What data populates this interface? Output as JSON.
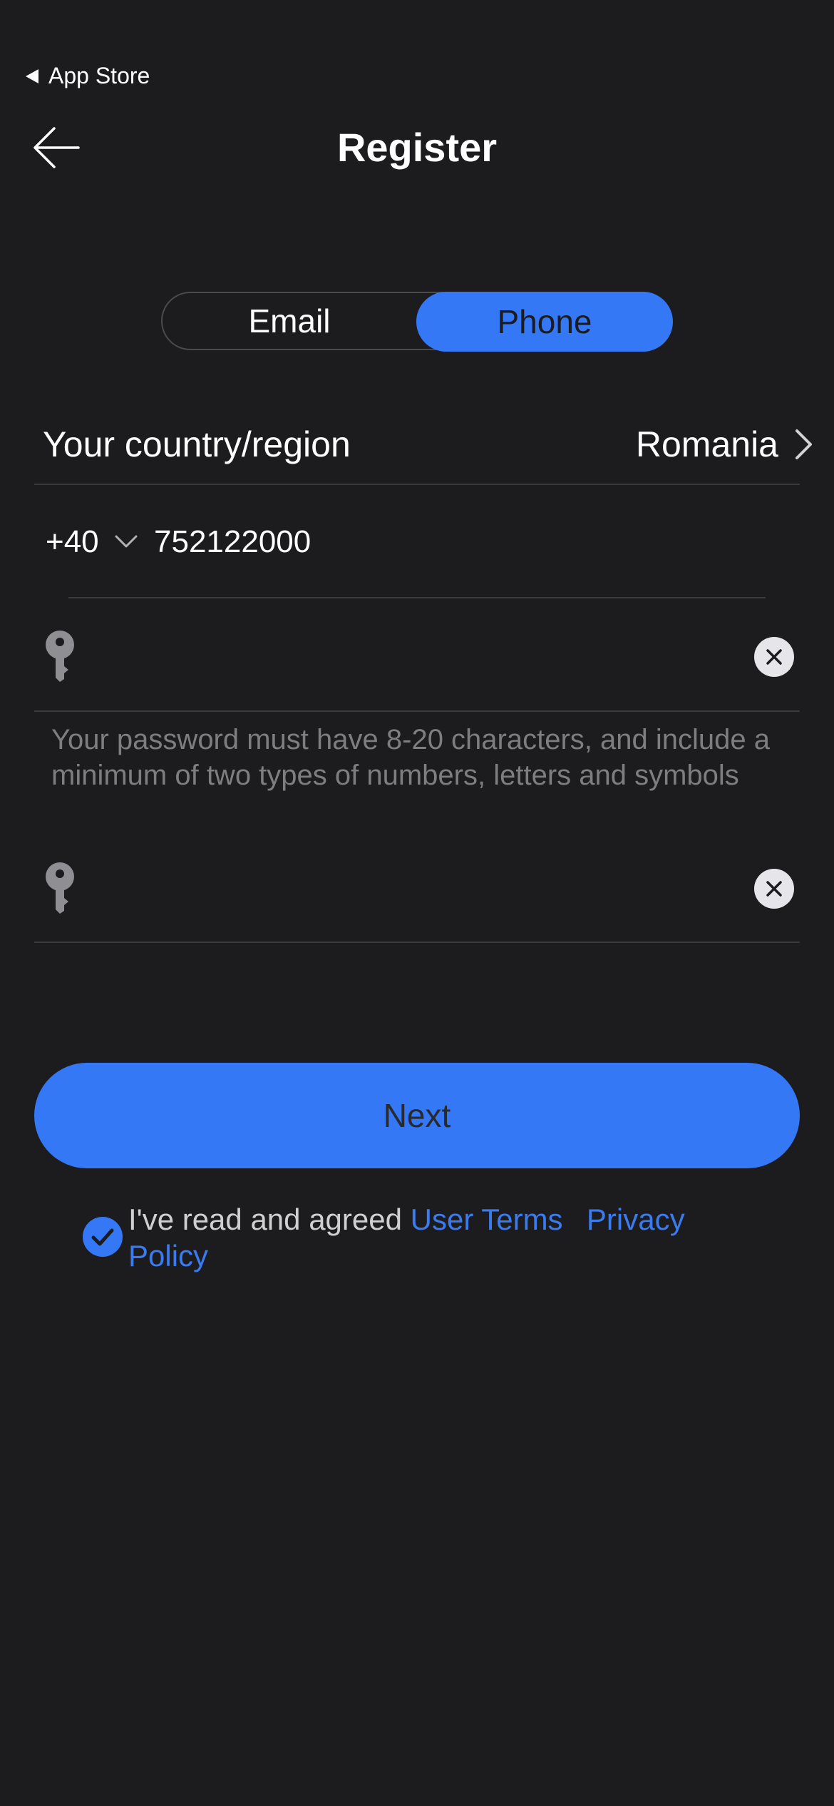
{
  "status_bar": {
    "back_to_app_label": "App Store"
  },
  "header": {
    "title": "Register"
  },
  "segmented": {
    "options": [
      {
        "label": "Email",
        "selected": false
      },
      {
        "label": "Phone",
        "selected": true
      }
    ]
  },
  "country": {
    "label": "Your country/region",
    "value": "Romania"
  },
  "phone": {
    "dial_code": "+40",
    "number": "752122000"
  },
  "password": {
    "hint": "Your password must have 8-20 characters, and include a minimum of two types of numbers, letters and symbols"
  },
  "next_button": {
    "label": "Next"
  },
  "agreement": {
    "checked": true,
    "prefix": "I've read and agreed",
    "user_terms": "User Terms",
    "privacy_policy": "Privacy Policy"
  },
  "colors": {
    "background": "#1c1c1e",
    "accent": "#3478f6",
    "divider": "#3a3a3c",
    "hint_text": "#7d7d82"
  },
  "icons": [
    "back-arrow-icon",
    "chevron-right-icon",
    "chevron-down-icon",
    "key-icon",
    "clear-icon",
    "checkmark-icon"
  ]
}
